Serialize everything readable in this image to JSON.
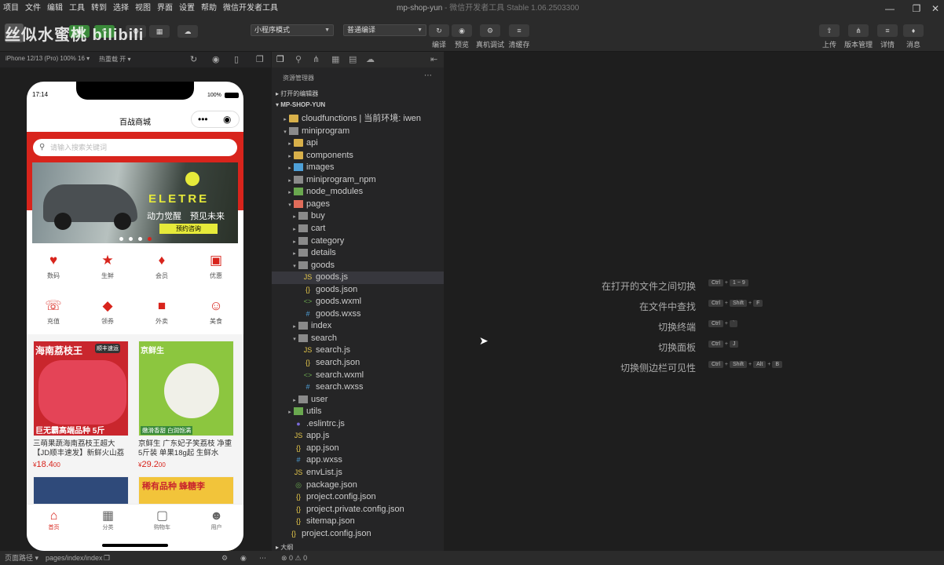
{
  "menubar": {
    "items": [
      "项目",
      "文件",
      "编辑",
      "工具",
      "转到",
      "选择",
      "视图",
      "界面",
      "设置",
      "帮助",
      "微信开发者工具"
    ],
    "title": "mp-shop-yun",
    "subtitle": "- 微信开发者工具 Stable 1.06.2503300"
  },
  "watermark": "丝似水蜜桃 bilibili",
  "toolbar": {
    "mode_select": "小程序模式",
    "compile_select": "普通编译",
    "left_btns": [
      "模拟器",
      "编辑器",
      "调试器",
      "可视化",
      "云开发"
    ],
    "compile": "编译",
    "preview": "预览",
    "device_debug": "真机调试",
    "clear_cache": "清缓存",
    "upload": "上传",
    "version": "版本管理",
    "details": "详情",
    "messages": "消息"
  },
  "simulator": {
    "device": "iPhone 12/13 (Pro) 100% 16 ▾",
    "hot_reload": "热重载 开 ▾"
  },
  "phone": {
    "time": "17:14",
    "battery": "100%",
    "title": "百战商城",
    "search_placeholder": "请输入搜索关键词",
    "banner_brand": "ELETRE",
    "banner_slogan": "动力觉醒　预见未来",
    "banner_button": "预约咨询",
    "categories": [
      {
        "icon": "♥",
        "label": "数码"
      },
      {
        "icon": "★",
        "label": "生鲜"
      },
      {
        "icon": "♦",
        "label": "会员"
      },
      {
        "icon": "▣",
        "label": "优惠"
      },
      {
        "icon": "☏",
        "label": "充值"
      },
      {
        "icon": "◆",
        "label": "领券"
      },
      {
        "icon": "■",
        "label": "外卖"
      },
      {
        "icon": "☺",
        "label": "美食"
      }
    ],
    "products": [
      {
        "img_title": "海南荔枝王",
        "img_badge": "顺丰速运",
        "img_bottom": "巨无霸高端品种 5斤",
        "name": "三萌果蔬海南荔枝王超大【JD顺丰速发】新鲜火山荔",
        "price_int": "18.4",
        "price_dec": "00",
        "currency": "¥"
      },
      {
        "img_title": "京鲜生",
        "img_badge": "",
        "img_bottom": "嫩滑香甜 白润饱满",
        "name": "京鲜生 广东妃子笑荔枝 净重5斤装 单果18g起 生鲜水",
        "price_int": "29.2",
        "price_dec": "00",
        "currency": "¥"
      },
      {
        "img_title": "",
        "img_badge": "",
        "img_bottom": "",
        "name": "",
        "price_int": "",
        "price_dec": "",
        "currency": ""
      },
      {
        "img_title": "稀有品种 蜂糖李",
        "img_badge": "",
        "img_bottom": "",
        "name": "",
        "price_int": "",
        "price_dec": "",
        "currency": ""
      }
    ],
    "tabs": [
      "首页",
      "分类",
      "购物车",
      "用户"
    ]
  },
  "explorer": {
    "header": "资源管理器",
    "open_editors": "打开的编辑器",
    "project": "MP-SHOP-YUN",
    "outline": "大纲",
    "tree": [
      {
        "label": "cloudfunctions | 当前环境: iwen",
        "depth": 1,
        "kind": "folder",
        "arrow": "▸"
      },
      {
        "label": "miniprogram",
        "depth": 1,
        "kind": "folder-grey",
        "arrow": "▾"
      },
      {
        "label": "api",
        "depth": 2,
        "kind": "folder",
        "arrow": "▸"
      },
      {
        "label": "components",
        "depth": 2,
        "kind": "folder",
        "arrow": "▸"
      },
      {
        "label": "images",
        "depth": 2,
        "kind": "folder-blue",
        "arrow": "▸"
      },
      {
        "label": "miniprogram_npm",
        "depth": 2,
        "kind": "folder-grey",
        "arrow": "▸"
      },
      {
        "label": "node_modules",
        "depth": 2,
        "kind": "folder-green",
        "arrow": "▸"
      },
      {
        "label": "pages",
        "depth": 2,
        "kind": "folder-red",
        "arrow": "▾"
      },
      {
        "label": "buy",
        "depth": 3,
        "kind": "folder-grey",
        "arrow": "▸"
      },
      {
        "label": "cart",
        "depth": 3,
        "kind": "folder-grey",
        "arrow": "▸"
      },
      {
        "label": "category",
        "depth": 3,
        "kind": "folder-grey",
        "arrow": "▸"
      },
      {
        "label": "details",
        "depth": 3,
        "kind": "folder-grey",
        "arrow": "▸"
      },
      {
        "label": "goods",
        "depth": 3,
        "kind": "folder-grey",
        "arrow": "▾"
      },
      {
        "label": "goods.js",
        "depth": 4,
        "kind": "js",
        "arrow": "",
        "selected": true
      },
      {
        "label": "goods.json",
        "depth": 4,
        "kind": "json",
        "arrow": ""
      },
      {
        "label": "goods.wxml",
        "depth": 4,
        "kind": "wxml",
        "arrow": ""
      },
      {
        "label": "goods.wxss",
        "depth": 4,
        "kind": "wxss",
        "arrow": ""
      },
      {
        "label": "index",
        "depth": 3,
        "kind": "folder-grey",
        "arrow": "▸"
      },
      {
        "label": "search",
        "depth": 3,
        "kind": "folder-grey",
        "arrow": "▾"
      },
      {
        "label": "search.js",
        "depth": 4,
        "kind": "js",
        "arrow": ""
      },
      {
        "label": "search.json",
        "depth": 4,
        "kind": "json",
        "arrow": ""
      },
      {
        "label": "search.wxml",
        "depth": 4,
        "kind": "wxml",
        "arrow": ""
      },
      {
        "label": "search.wxss",
        "depth": 4,
        "kind": "wxss",
        "arrow": ""
      },
      {
        "label": "user",
        "depth": 3,
        "kind": "folder-grey",
        "arrow": "▸"
      },
      {
        "label": "utils",
        "depth": 2,
        "kind": "folder-green",
        "arrow": "▸"
      },
      {
        "label": ".eslintrc.js",
        "depth": 2,
        "kind": "eslint",
        "arrow": ""
      },
      {
        "label": "app.js",
        "depth": 2,
        "kind": "js",
        "arrow": ""
      },
      {
        "label": "app.json",
        "depth": 2,
        "kind": "json",
        "arrow": ""
      },
      {
        "label": "app.wxss",
        "depth": 2,
        "kind": "wxss",
        "arrow": ""
      },
      {
        "label": "envList.js",
        "depth": 2,
        "kind": "js",
        "arrow": ""
      },
      {
        "label": "package.json",
        "depth": 2,
        "kind": "pkg",
        "arrow": ""
      },
      {
        "label": "project.config.json",
        "depth": 2,
        "kind": "json",
        "arrow": ""
      },
      {
        "label": "project.private.config.json",
        "depth": 2,
        "kind": "json",
        "arrow": ""
      },
      {
        "label": "sitemap.json",
        "depth": 2,
        "kind": "json",
        "arrow": ""
      },
      {
        "label": "project.config.json",
        "depth": 1,
        "kind": "json",
        "arrow": ""
      }
    ]
  },
  "editor": {
    "shortcuts": [
      {
        "label": "在打开的文件之间切换",
        "keys": [
          "Ctrl",
          "1 ~ 9"
        ]
      },
      {
        "label": "在文件中查找",
        "keys": [
          "Ctrl",
          "Shift",
          "F"
        ]
      },
      {
        "label": "切换终端",
        "keys": [
          "Ctrl",
          "`"
        ]
      },
      {
        "label": "切换面板",
        "keys": [
          "Ctrl",
          "J"
        ]
      },
      {
        "label": "切换侧边栏可见性",
        "keys": [
          "Ctrl",
          "Shift",
          "Alt",
          "B"
        ]
      }
    ]
  },
  "statusbar": {
    "page_path_label": "页面路径 ▾",
    "page_path": "pages/index/index",
    "errors": "⊗ 0 ⚠ 0"
  }
}
